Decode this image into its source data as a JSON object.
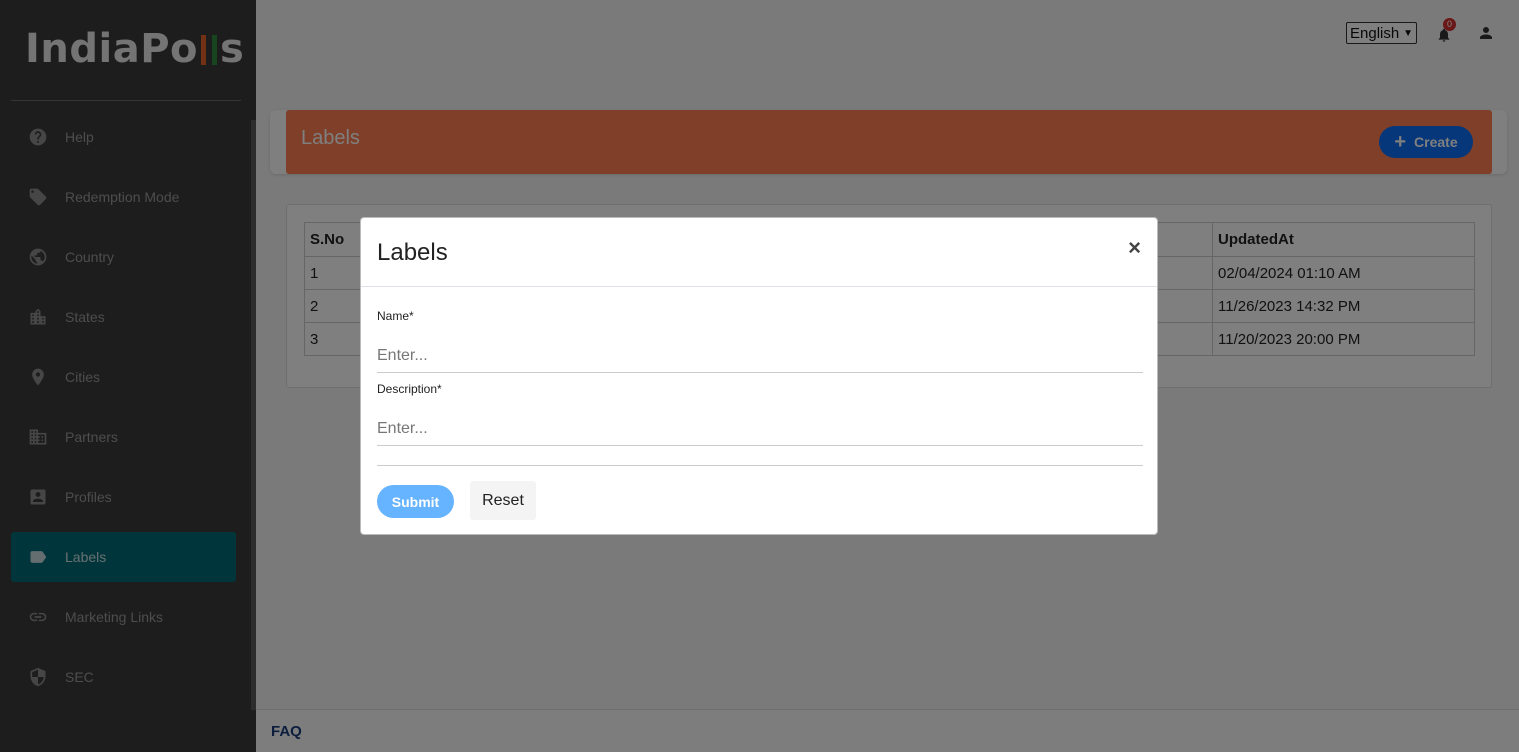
{
  "app": {
    "logo_text_1": "IndiaPo",
    "logo_text_2": "s",
    "logo_bar_colors": [
      "#e4622a",
      "#2e8b3e"
    ]
  },
  "sidebar": {
    "items": [
      {
        "label": "Help",
        "icon": "help-icon"
      },
      {
        "label": "Redemption Mode",
        "icon": "tag-icon"
      },
      {
        "label": "Country",
        "icon": "globe-icon"
      },
      {
        "label": "States",
        "icon": "city-icon"
      },
      {
        "label": "Cities",
        "icon": "location-pin-icon"
      },
      {
        "label": "Partners",
        "icon": "building-icon"
      },
      {
        "label": "Profiles",
        "icon": "profile-card-icon"
      },
      {
        "label": "Labels",
        "icon": "label-icon",
        "active": true
      },
      {
        "label": "Marketing Links",
        "icon": "link-icon"
      },
      {
        "label": "SEC",
        "icon": "shield-icon"
      }
    ]
  },
  "topbar": {
    "language": "English",
    "notification_count": "0"
  },
  "page": {
    "title": "Labels",
    "create_label": "Create",
    "accent_color": "#ff7f50"
  },
  "table": {
    "headers": {
      "sno": "S.No",
      "updated": "UpdatedAt"
    },
    "rows": [
      {
        "sno": "1",
        "updated": "02/04/2024 01:10 AM"
      },
      {
        "sno": "2",
        "updated": "11/26/2023 14:32 PM"
      },
      {
        "sno": "3",
        "updated": "11/20/2023 20:00 PM"
      }
    ]
  },
  "footer": {
    "faq": "FAQ"
  },
  "modal": {
    "title": "Labels",
    "close": "×",
    "name_label": "Name*",
    "name_placeholder": "Enter...",
    "description_label": "Description*",
    "description_placeholder": "Enter...",
    "submit_label": "Submit",
    "reset_label": "Reset"
  }
}
